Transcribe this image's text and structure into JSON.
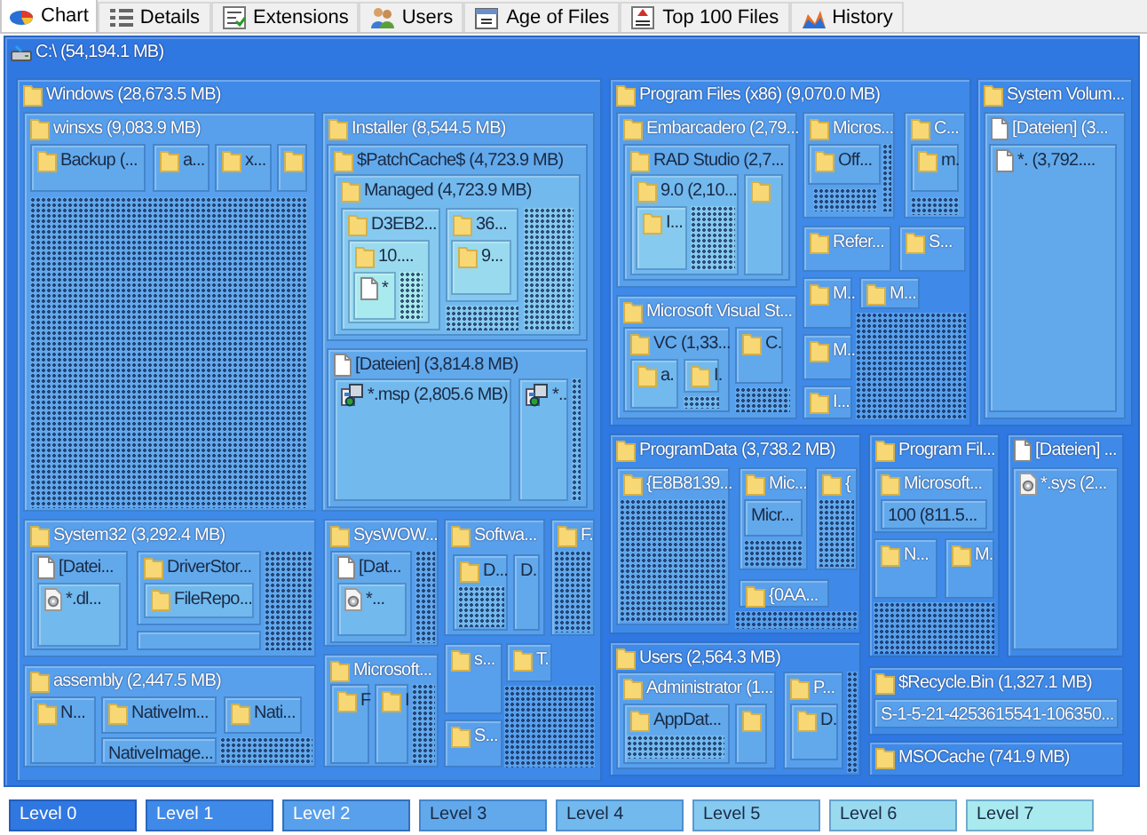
{
  "tabs": [
    {
      "label": "Chart",
      "selected": true
    },
    {
      "label": "Details",
      "selected": false
    },
    {
      "label": "Extensions",
      "selected": false
    },
    {
      "label": "Users",
      "selected": false
    },
    {
      "label": "Age of Files",
      "selected": false
    },
    {
      "label": "Top 100 Files",
      "selected": false
    },
    {
      "label": "History",
      "selected": false
    }
  ],
  "treemap": {
    "label": "C:\\ (54,194.1 MB)",
    "kind": "drive",
    "children": [
      {
        "label": "Windows (28,673.5 MB)",
        "kind": "folder",
        "children": [
          {
            "label": "winsxs (9,083.9 MB)",
            "kind": "folder",
            "children": [
              {
                "label": "Backup (...",
                "kind": "folder"
              },
              {
                "label": "a...",
                "kind": "folder"
              },
              {
                "label": "x...",
                "kind": "folder"
              },
              {
                "kind": "folder"
              },
              {
                "kind": "dots"
              }
            ]
          },
          {
            "label": "Installer (8,544.5 MB)",
            "kind": "folder",
            "children": [
              {
                "label": "$PatchCache$ (4,723.9 MB)",
                "kind": "folder",
                "children": [
                  {
                    "label": "Managed (4,723.9 MB)",
                    "kind": "folder",
                    "children": [
                      {
                        "label": "D3EB2...",
                        "kind": "folder",
                        "children": [
                          {
                            "label": "10....",
                            "kind": "folder",
                            "children": [
                              {
                                "label": "*",
                                "kind": "file"
                              },
                              {
                                "kind": "dots"
                              }
                            ]
                          }
                        ]
                      },
                      {
                        "label": "36...",
                        "kind": "folder",
                        "children": [
                          {
                            "label": "9...",
                            "kind": "folder"
                          }
                        ]
                      },
                      {
                        "kind": "dots"
                      },
                      {
                        "kind": "dots"
                      }
                    ]
                  }
                ]
              },
              {
                "label": "[Dateien] (3,814.8 MB)",
                "kind": "file",
                "children": [
                  {
                    "label": "*.msp (2,805.6 MB)",
                    "kind": "msp"
                  },
                  {
                    "label": "*..",
                    "kind": "msp"
                  },
                  {
                    "kind": "dots"
                  }
                ]
              }
            ]
          },
          {
            "label": "System32 (3,292.4 MB)",
            "kind": "folder",
            "children": [
              {
                "label": "[Datei...",
                "kind": "file",
                "children": [
                  {
                    "label": "*.dl...",
                    "kind": "gearfile"
                  }
                ]
              },
              {
                "label": "DriverStor...",
                "kind": "folder",
                "children": [
                  {
                    "label": "FileRepo...",
                    "kind": "folder"
                  }
                ]
              },
              {
                "kind": "plain"
              },
              {
                "kind": "dots"
              }
            ]
          },
          {
            "label": "assembly (2,447.5 MB)",
            "kind": "folder",
            "children": [
              {
                "label": "N...",
                "kind": "folder"
              },
              {
                "label": "NativeIm...",
                "kind": "folder"
              },
              {
                "label": "Nati...",
                "kind": "folder"
              },
              {
                "label": "NativeImage...",
                "kind": "plain"
              },
              {
                "kind": "dots"
              }
            ]
          },
          {
            "label": "SysWOW...",
            "kind": "folder",
            "children": [
              {
                "label": "[Dat...",
                "kind": "file",
                "children": [
                  {
                    "label": "*...",
                    "kind": "gearfile"
                  }
                ]
              },
              {
                "kind": "dots"
              }
            ]
          },
          {
            "label": "Softwa...",
            "kind": "folder",
            "children": [
              {
                "label": "D...",
                "kind": "folder",
                "children": [
                  {
                    "kind": "dots"
                  }
                ]
              },
              {
                "label": "D.",
                "kind": "plain"
              }
            ]
          },
          {
            "label": "F.",
            "kind": "folder",
            "children": [
              {
                "kind": "dots"
              }
            ]
          },
          {
            "label": "Microsoft...",
            "kind": "folder",
            "children": [
              {
                "label": "F",
                "kind": "folder"
              },
              {
                "label": "I",
                "kind": "folder"
              },
              {
                "kind": "dots"
              }
            ]
          },
          {
            "label": "s...",
            "kind": "folder"
          },
          {
            "label": "T.",
            "kind": "folder"
          },
          {
            "label": "S...",
            "kind": "folder"
          },
          {
            "kind": "dots"
          }
        ]
      },
      {
        "label": "Program Files (x86) (9,070.0 MB)",
        "kind": "folder",
        "children": [
          {
            "label": "Embarcadero (2,79...",
            "kind": "folder",
            "children": [
              {
                "label": "RAD Studio (2,7...",
                "kind": "folder",
                "children": [
                  {
                    "label": "9.0 (2,10...",
                    "kind": "folder",
                    "children": [
                      {
                        "label": "I...",
                        "kind": "folder"
                      },
                      {
                        "kind": "dots"
                      }
                    ]
                  },
                  {
                    "kind": "folder"
                  }
                ]
              }
            ]
          },
          {
            "label": "Micros...",
            "kind": "folder",
            "children": [
              {
                "label": "Off...",
                "kind": "folder"
              },
              {
                "kind": "dots"
              },
              {
                "kind": "dots"
              }
            ]
          },
          {
            "label": "C...",
            "kind": "folder",
            "children": [
              {
                "label": "m.",
                "kind": "folder"
              },
              {
                "kind": "dots"
              }
            ]
          },
          {
            "label": "Refer...",
            "kind": "folder"
          },
          {
            "label": "S...",
            "kind": "folder"
          },
          {
            "label": "Microsoft Visual St...",
            "kind": "folder",
            "children": [
              {
                "label": "VC (1,33...",
                "kind": "folder",
                "children": [
                  {
                    "label": "a.",
                    "kind": "folder"
                  },
                  {
                    "label": "I.",
                    "kind": "folder"
                  },
                  {
                    "kind": "dots"
                  }
                ]
              },
              {
                "label": "C.",
                "kind": "folder"
              },
              {
                "kind": "dots"
              }
            ]
          },
          {
            "label": "M..",
            "kind": "folder"
          },
          {
            "label": "M...",
            "kind": "folder"
          },
          {
            "label": "M..",
            "kind": "folder"
          },
          {
            "label": "I...",
            "kind": "folder"
          },
          {
            "kind": "dots"
          }
        ]
      },
      {
        "label": "System Volum...",
        "kind": "folder",
        "children": [
          {
            "label": "[Dateien] (3...",
            "kind": "file",
            "children": [
              {
                "label": "*. (3,792....",
                "kind": "file"
              }
            ]
          }
        ]
      },
      {
        "label": "ProgramData (3,738.2 MB)",
        "kind": "folder",
        "children": [
          {
            "label": "{E8B8139...",
            "kind": "folder",
            "children": [
              {
                "kind": "dots"
              }
            ]
          },
          {
            "label": "Mic...",
            "kind": "folder",
            "children": [
              {
                "label": "Micr...",
                "kind": "plain"
              },
              {
                "kind": "dots"
              }
            ]
          },
          {
            "label": "{",
            "kind": "folder",
            "children": [
              {
                "kind": "dots"
              }
            ]
          },
          {
            "label": "{0AA...",
            "kind": "folder"
          },
          {
            "kind": "dots"
          }
        ]
      },
      {
        "label": "Program Fil...",
        "kind": "folder",
        "children": [
          {
            "label": "Microsoft...",
            "kind": "folder",
            "children": [
              {
                "label": "100 (811.5...",
                "kind": "plain"
              }
            ]
          },
          {
            "label": "N...",
            "kind": "folder"
          },
          {
            "label": "M.",
            "kind": "folder"
          },
          {
            "kind": "dots"
          }
        ]
      },
      {
        "label": "[Dateien] ...",
        "kind": "file",
        "children": [
          {
            "label": "*.sys (2...",
            "kind": "gearfile"
          }
        ]
      },
      {
        "label": "Users (2,564.3 MB)",
        "kind": "folder",
        "children": [
          {
            "label": "Administrator (1...",
            "kind": "folder",
            "children": [
              {
                "label": "AppDat...",
                "kind": "folder",
                "children": [
                  {
                    "kind": "dots"
                  }
                ]
              },
              {
                "kind": "folder"
              }
            ]
          },
          {
            "label": "P...",
            "kind": "folder",
            "children": [
              {
                "label": "D.",
                "kind": "folder"
              }
            ]
          },
          {
            "kind": "dots"
          }
        ]
      },
      {
        "label": "$Recycle.Bin (1,327.1 MB)",
        "kind": "folder",
        "children": [
          {
            "label": "S-1-5-21-4253615541-106350...",
            "kind": "plain"
          }
        ]
      },
      {
        "label": "MSOCache (741.9 MB)",
        "kind": "folder"
      }
    ]
  },
  "levels": [
    {
      "label": "Level 0",
      "color": "#2f77e1"
    },
    {
      "label": "Level 1",
      "color": "#3f8ae8"
    },
    {
      "label": "Level 2",
      "color": "#58a0ec"
    },
    {
      "label": "Level 3",
      "color": "#62a9ec"
    },
    {
      "label": "Level 4",
      "color": "#72b9ee"
    },
    {
      "label": "Level 5",
      "color": "#86caf0"
    },
    {
      "label": "Level 6",
      "color": "#99daef"
    },
    {
      "label": "Level 7",
      "color": "#a8eaee"
    }
  ]
}
